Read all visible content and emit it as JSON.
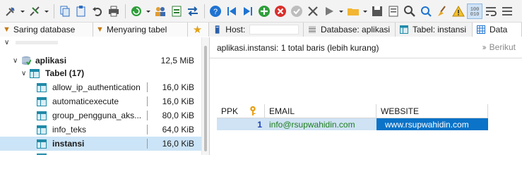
{
  "left_tabs": {
    "filter_db": "Saring database",
    "filter_table": "Menyaring tabel"
  },
  "right_tabs": {
    "host": "Host:",
    "database": "Database: aplikasi",
    "table": "Tabel: instansi",
    "data": "Data"
  },
  "tree": {
    "database": {
      "name": "aplikasi",
      "size": "12,5 MiB"
    },
    "tables_group": "Tabel (17)",
    "tables": [
      {
        "name": "allow_ip_authentication",
        "size": "16,0 KiB"
      },
      {
        "name": "automaticexecute",
        "size": "16,0 KiB"
      },
      {
        "name": "group_pengguna_aks...",
        "size": "80,0 KiB"
      },
      {
        "name": "info_teks",
        "size": "64,0 KiB"
      },
      {
        "name": "instansi",
        "size": "16,0 KiB"
      }
    ]
  },
  "content": {
    "info": "aplikasi.instansi: 1 total baris (lebih kurang)",
    "next_label": "Berikut",
    "columns": [
      "PPK",
      "EMAIL",
      "WEBSITE"
    ],
    "row": {
      "ppk": "1",
      "email": "info@rsupwahidin.com",
      "website": "www.rsupwahidin.com"
    }
  },
  "colors": {
    "selection": "#cce4f7",
    "website_cell": "#0b73c8",
    "email_text": "#1e7d1e",
    "ppk_text": "#1d3fb3"
  }
}
